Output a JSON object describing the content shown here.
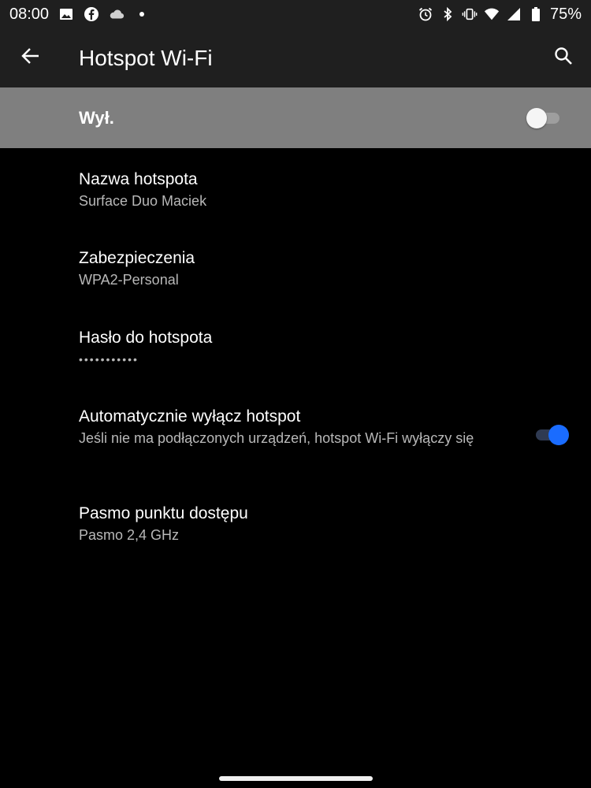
{
  "status_bar": {
    "time": "08:00",
    "left_icons": [
      "image-icon",
      "facebook-icon",
      "cloud-icon",
      "dot-icon"
    ],
    "right_icons": [
      "alarm-icon",
      "bluetooth-icon",
      "vibrate-icon",
      "wifi-icon",
      "signal-icon",
      "battery-icon"
    ],
    "battery": "75%"
  },
  "app_bar": {
    "title": "Hotspot Wi-Fi",
    "back_icon": "arrow-left-icon",
    "search_icon": "search-icon"
  },
  "master_switch": {
    "label": "Wył.",
    "state": "off"
  },
  "settings": [
    {
      "title": "Nazwa hotspota",
      "subtitle": "Surface Duo Maciek"
    },
    {
      "title": "Zabezpieczenia",
      "subtitle": "WPA2-Personal"
    },
    {
      "title": "Hasło do hotspota",
      "subtitle": "•••••••••••"
    },
    {
      "title": "Automatycznie wyłącz hotspot",
      "subtitle": "Jeśli nie ma podłączonych urządzeń, hotspot Wi-Fi wyłączy się",
      "toggle": "on"
    },
    {
      "title": "Pasmo punktu dostępu",
      "subtitle": "Pasmo 2,4 GHz"
    }
  ],
  "colors": {
    "accent": "#1a6cff",
    "bar_background": "#1f1f1f",
    "master_background": "#7f7f7f"
  }
}
